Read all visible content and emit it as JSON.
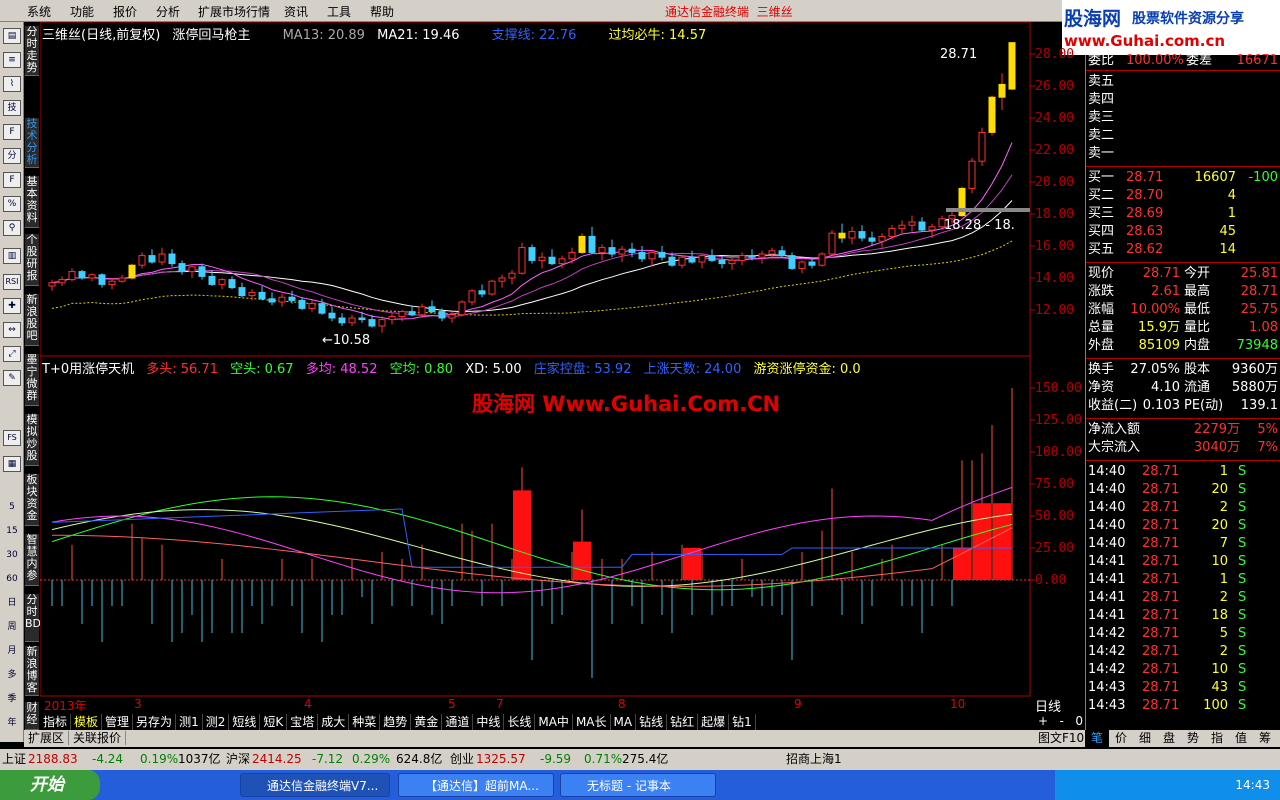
{
  "menu": [
    "系统",
    "功能",
    "报价",
    "分析",
    "扩展市场行情",
    "资讯",
    "工具",
    "帮助"
  ],
  "app_title": "通达信金融终端",
  "app_stock": "三维丝",
  "logo": {
    "line1": "股海网",
    "line2": "股票软件资源分享",
    "line3": "www.Guhai.com.cn"
  },
  "left_icons": [
    "技",
    "分",
    "RSI",
    "FS",
    "5",
    "15",
    "30",
    "60",
    "日",
    "周",
    "月",
    "多",
    "季",
    "年"
  ],
  "left_tabs": [
    "分时走势",
    "技术分析",
    "基本资料",
    "个股研报",
    "新浪股吧",
    "墨宁微群",
    "模拟炒股",
    "板块资金",
    "智慧内参",
    "分时BD",
    "新浪博客",
    "财经"
  ],
  "main_header": {
    "name": "三维丝(日线,前复权)",
    "formula": "涨停回马枪主",
    "ma13": "MA13: 20.89",
    "ma21": "MA21: 19.46",
    "support": "支撑线: 22.76",
    "cross": "过均必牛: 14.57"
  },
  "price_axis": [
    "28.00",
    "26.00",
    "24.00",
    "22.00",
    "20.00",
    "18.00",
    "16.00",
    "14.00",
    "12.00"
  ],
  "price_annotations": {
    "high": "28.71",
    "low": "←10.58",
    "level": "18.28 - 18."
  },
  "ind_header": {
    "name": "T+0用涨停天机",
    "duo": "多头: 56.71",
    "kong": "空头: 0.67",
    "duojun": "多均: 48.52",
    "kongjun": "空均: 0.80",
    "xd": "XD: 5.00",
    "zhuang": "庄家控盘: 53.92",
    "days": "上涨天数: 24.00",
    "youzi": "游资涨停资金: 0.0"
  },
  "ind_axis": [
    "150.00",
    "125.00",
    "100.00",
    "75.00",
    "50.00",
    "25.00",
    "0.00"
  ],
  "watermark": "股海网 Www.Guhai.Com.CN",
  "dates": [
    "2013年",
    "3",
    "4",
    "5",
    "7",
    "8",
    "9",
    "10"
  ],
  "period": "日线",
  "bottom_tabs": [
    "指标",
    "模板",
    "管理",
    "另存为",
    "测1",
    "测2",
    "短线",
    "短K",
    "宝塔",
    "成大",
    "种菜",
    "趋势",
    "黄金",
    "通道",
    "中线",
    "长线",
    "MA中",
    "MA长",
    "MA",
    "钻线",
    "钻红",
    "起爆",
    "钻1"
  ],
  "zoom": [
    "+",
    "-",
    "0"
  ],
  "extra": [
    "扩展区",
    "关联报价"
  ],
  "tuf": "图文F10",
  "quote": {
    "webi": {
      "label": "委比",
      "value": "100.00%",
      "label2": "委差",
      "value2": "16671"
    },
    "sells": [
      {
        "label": "卖五"
      },
      {
        "label": "卖四"
      },
      {
        "label": "卖三"
      },
      {
        "label": "卖二"
      },
      {
        "label": "卖一"
      }
    ],
    "buys": [
      {
        "label": "买一",
        "price": "28.71",
        "vol": "16607",
        "chg": "-100"
      },
      {
        "label": "买二",
        "price": "28.70",
        "vol": "4",
        "chg": ""
      },
      {
        "label": "买三",
        "price": "28.69",
        "vol": "1",
        "chg": ""
      },
      {
        "label": "买四",
        "price": "28.63",
        "vol": "45",
        "chg": ""
      },
      {
        "label": "买五",
        "price": "28.62",
        "vol": "14",
        "chg": ""
      }
    ],
    "stats": [
      {
        "l1": "现价",
        "v1": "28.71",
        "l2": "今开",
        "v2": "25.81"
      },
      {
        "l1": "涨跌",
        "v1": "2.61",
        "l2": "最高",
        "v2": "28.71"
      },
      {
        "l1": "涨幅",
        "v1": "10.00%",
        "l2": "最低",
        "v2": "25.75"
      },
      {
        "l1": "总量",
        "v1": "15.9万",
        "l2": "量比",
        "v2": "1.08"
      },
      {
        "l1": "外盘",
        "v1": "85109",
        "l2": "内盘",
        "v2": "73948"
      }
    ],
    "stats2": [
      {
        "l1": "换手",
        "v1": "27.05%",
        "l2": "股本",
        "v2": "9360万"
      },
      {
        "l1": "净资",
        "v1": "4.10",
        "l2": "流通",
        "v2": "5880万"
      },
      {
        "l1": "收益(二)",
        "v1": "0.103",
        "l2": "PE(动)",
        "v2": "139.1"
      }
    ],
    "flows": [
      {
        "label": "净流入额",
        "value": "2279万",
        "pct": "5%"
      },
      {
        "label": "大宗流入",
        "value": "3040万",
        "pct": "7%"
      }
    ],
    "ticks": [
      {
        "t": "14:40",
        "p": "28.71",
        "v": "1",
        "s": "S"
      },
      {
        "t": "14:40",
        "p": "28.71",
        "v": "20",
        "s": "S"
      },
      {
        "t": "14:40",
        "p": "28.71",
        "v": "2",
        "s": "S"
      },
      {
        "t": "14:40",
        "p": "28.71",
        "v": "20",
        "s": "S"
      },
      {
        "t": "14:40",
        "p": "28.71",
        "v": "7",
        "s": "S"
      },
      {
        "t": "14:41",
        "p": "28.71",
        "v": "10",
        "s": "S"
      },
      {
        "t": "14:41",
        "p": "28.71",
        "v": "1",
        "s": "S"
      },
      {
        "t": "14:41",
        "p": "28.71",
        "v": "2",
        "s": "S"
      },
      {
        "t": "14:41",
        "p": "28.71",
        "v": "18",
        "s": "S"
      },
      {
        "t": "14:42",
        "p": "28.71",
        "v": "5",
        "s": "S"
      },
      {
        "t": "14:42",
        "p": "28.71",
        "v": "2",
        "s": "S"
      },
      {
        "t": "14:42",
        "p": "28.71",
        "v": "10",
        "s": "S"
      },
      {
        "t": "14:43",
        "p": "28.71",
        "v": "43",
        "s": "S"
      },
      {
        "t": "14:43",
        "p": "28.71",
        "v": "100",
        "s": "S"
      }
    ]
  },
  "right_tabs": [
    "笔",
    "价",
    "细",
    "盘",
    "势",
    "指",
    "值",
    "筹"
  ],
  "status": {
    "sh": "上证",
    "sh_val": "2188.83",
    "sh_chg": "-4.24",
    "sh_pct": "0.19%",
    "sh_amt": "1037亿",
    "hs": "沪深",
    "hs_val": "2414.25",
    "hs_chg": "-7.12",
    "hs_pct": "0.29%",
    "hs_amt": "624.8亿",
    "cy": "创业",
    "cy_val": "1325.57",
    "cy_chg": "-9.59",
    "cy_pct": "0.71%",
    "cy_amt": "275.4亿",
    "broker": "招商上海1"
  },
  "taskbar": {
    "start": "开始",
    "tasks": [
      "通达信金融终端V7...",
      "【通达信】超前MA...",
      "无标题 - 记事本"
    ],
    "clock": "14:43"
  },
  "chart_data": {
    "type": "candlestick",
    "title": "三维丝(日线,前复权)",
    "ylim": [
      10.0,
      29.0
    ],
    "candles": [
      [
        13.5,
        13.9,
        13.2,
        13.7
      ],
      [
        13.7,
        14.1,
        13.5,
        13.9
      ],
      [
        13.9,
        14.6,
        13.8,
        14.4
      ],
      [
        14.4,
        14.5,
        13.9,
        14.0
      ],
      [
        14.0,
        14.3,
        13.8,
        14.2
      ],
      [
        14.2,
        14.3,
        13.4,
        13.6
      ],
      [
        13.6,
        14.0,
        13.3,
        13.8
      ],
      [
        13.8,
        14.2,
        13.7,
        14.0
      ],
      [
        14.0,
        14.9,
        13.9,
        14.8
      ],
      [
        14.8,
        15.6,
        14.6,
        15.4
      ],
      [
        15.4,
        15.8,
        14.9,
        15.0
      ],
      [
        15.0,
        15.9,
        14.8,
        15.5
      ],
      [
        15.5,
        15.8,
        14.7,
        14.9
      ],
      [
        14.9,
        15.1,
        14.2,
        14.4
      ],
      [
        14.4,
        14.8,
        14.0,
        14.7
      ],
      [
        14.7,
        14.9,
        13.9,
        14.1
      ],
      [
        14.1,
        14.5,
        13.5,
        13.6
      ],
      [
        13.6,
        14.0,
        13.3,
        13.9
      ],
      [
        13.9,
        14.1,
        13.3,
        13.4
      ],
      [
        13.4,
        13.7,
        12.8,
        12.9
      ],
      [
        12.9,
        13.3,
        12.6,
        13.1
      ],
      [
        13.1,
        13.5,
        12.6,
        12.7
      ],
      [
        12.7,
        13.1,
        12.3,
        12.5
      ],
      [
        12.5,
        13.0,
        12.2,
        12.8
      ],
      [
        12.8,
        13.2,
        12.4,
        12.6
      ],
      [
        12.6,
        12.8,
        12.0,
        12.1
      ],
      [
        12.1,
        12.6,
        11.9,
        12.4
      ],
      [
        12.4,
        12.7,
        11.7,
        11.8
      ],
      [
        11.8,
        12.2,
        11.3,
        11.5
      ],
      [
        11.5,
        11.8,
        11.0,
        11.2
      ],
      [
        11.2,
        11.7,
        11.0,
        11.5
      ],
      [
        11.5,
        11.9,
        11.2,
        11.4
      ],
      [
        11.4,
        11.7,
        10.9,
        11.0
      ],
      [
        11.0,
        11.6,
        10.58,
        11.4
      ],
      [
        11.4,
        11.8,
        11.1,
        11.6
      ],
      [
        11.6,
        12.0,
        11.3,
        11.9
      ],
      [
        11.9,
        12.3,
        11.6,
        11.7
      ],
      [
        11.7,
        12.4,
        11.5,
        12.2
      ],
      [
        12.2,
        12.6,
        11.8,
        11.9
      ],
      [
        11.9,
        12.1,
        11.3,
        11.5
      ],
      [
        11.5,
        11.9,
        11.2,
        11.7
      ],
      [
        11.7,
        12.6,
        11.6,
        12.5
      ],
      [
        12.5,
        13.3,
        12.3,
        13.2
      ],
      [
        13.2,
        13.6,
        12.8,
        13.0
      ],
      [
        13.0,
        13.9,
        12.9,
        13.8
      ],
      [
        13.8,
        14.2,
        13.4,
        14.0
      ],
      [
        14.0,
        14.5,
        13.6,
        14.3
      ],
      [
        14.3,
        16.2,
        14.2,
        15.9
      ],
      [
        15.9,
        16.1,
        14.9,
        15.1
      ],
      [
        15.1,
        15.6,
        14.6,
        15.3
      ],
      [
        15.3,
        15.8,
        14.8,
        14.9
      ],
      [
        14.9,
        15.4,
        14.6,
        15.2
      ],
      [
        15.2,
        15.9,
        14.9,
        15.6
      ],
      [
        15.6,
        16.8,
        15.5,
        16.6
      ],
      [
        16.6,
        17.2,
        15.5,
        15.6
      ],
      [
        15.6,
        16.1,
        15.1,
        15.9
      ],
      [
        15.9,
        16.4,
        15.3,
        15.5
      ],
      [
        15.5,
        16.0,
        15.0,
        15.8
      ],
      [
        15.8,
        16.2,
        15.3,
        15.6
      ],
      [
        15.6,
        16.0,
        15.0,
        15.2
      ],
      [
        15.2,
        15.7,
        14.7,
        15.6
      ],
      [
        15.6,
        16.0,
        15.1,
        15.3
      ],
      [
        15.3,
        15.6,
        14.7,
        14.8
      ],
      [
        14.8,
        15.4,
        14.6,
        15.3
      ],
      [
        15.3,
        15.7,
        14.9,
        15.0
      ],
      [
        15.0,
        15.5,
        14.6,
        15.4
      ],
      [
        15.4,
        15.8,
        15.0,
        15.1
      ],
      [
        15.1,
        15.4,
        14.6,
        14.9
      ],
      [
        14.9,
        15.3,
        14.5,
        15.1
      ],
      [
        15.1,
        15.6,
        14.8,
        15.4
      ],
      [
        15.4,
        15.8,
        15.1,
        15.3
      ],
      [
        15.3,
        15.7,
        14.9,
        15.5
      ],
      [
        15.5,
        15.9,
        15.2,
        15.7
      ],
      [
        15.7,
        16.0,
        15.3,
        15.4
      ],
      [
        15.4,
        15.6,
        14.5,
        14.6
      ],
      [
        14.6,
        15.1,
        14.3,
        15.0
      ],
      [
        15.0,
        15.3,
        14.6,
        14.8
      ],
      [
        14.8,
        15.6,
        14.7,
        15.5
      ],
      [
        15.5,
        17.0,
        15.4,
        16.8
      ],
      [
        16.8,
        17.4,
        16.2,
        16.5
      ],
      [
        16.5,
        17.2,
        16.1,
        16.9
      ],
      [
        16.9,
        17.3,
        16.3,
        16.5
      ],
      [
        16.5,
        16.9,
        16.0,
        16.3
      ],
      [
        16.3,
        16.8,
        15.9,
        16.6
      ],
      [
        16.6,
        17.3,
        16.4,
        17.1
      ],
      [
        17.1,
        17.6,
        16.8,
        17.3
      ],
      [
        17.3,
        17.9,
        16.9,
        17.5
      ],
      [
        17.5,
        17.8,
        16.9,
        17.0
      ],
      [
        17.0,
        17.4,
        16.5,
        17.2
      ],
      [
        17.2,
        17.9,
        17.0,
        17.7
      ],
      [
        17.7,
        18.3,
        17.4,
        17.9
      ],
      [
        17.9,
        19.7,
        17.8,
        19.6
      ],
      [
        19.6,
        21.5,
        19.3,
        21.3
      ],
      [
        21.3,
        23.4,
        21.0,
        23.1
      ],
      [
        23.1,
        25.4,
        22.9,
        25.3
      ],
      [
        25.3,
        26.8,
        24.5,
        26.1
      ],
      [
        25.81,
        28.71,
        25.75,
        28.71
      ]
    ],
    "ma_fast_label": "MA13",
    "ma_slow_label": "MA21",
    "ma13_last": 20.89,
    "ma21_last": 19.46,
    "support_last": 22.76
  }
}
